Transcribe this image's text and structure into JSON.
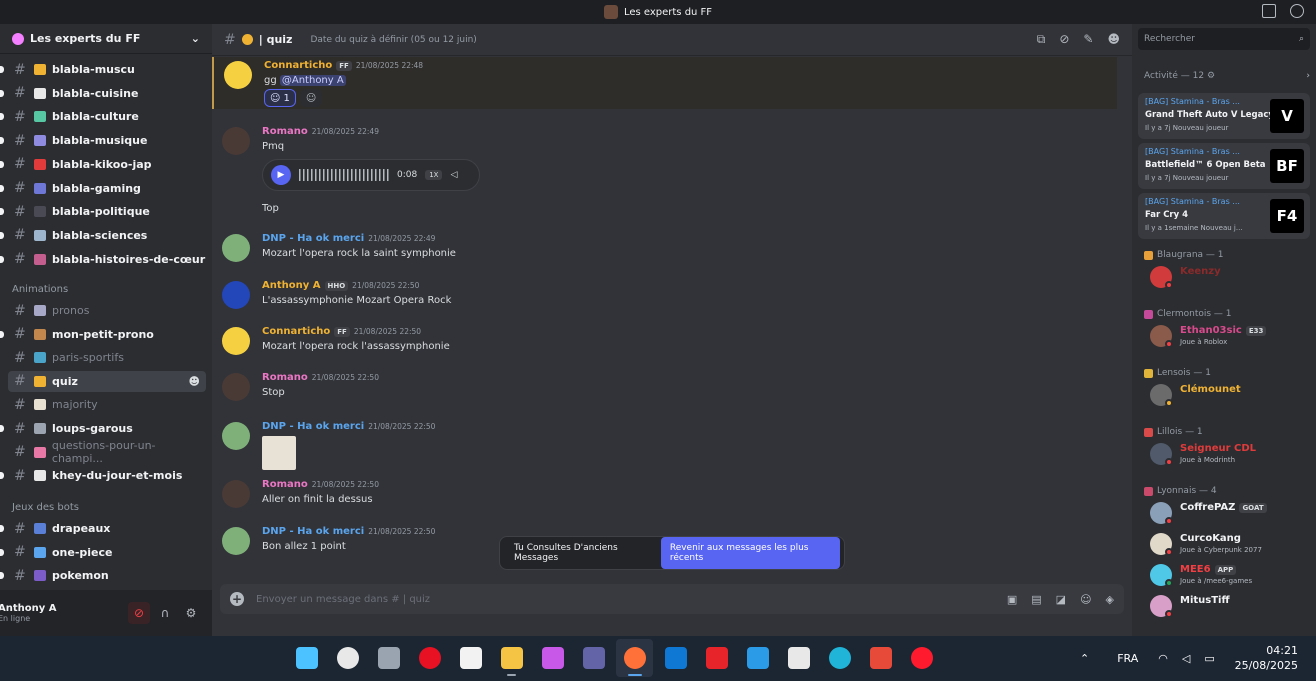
{
  "window": {
    "title": "Les experts du FF"
  },
  "server": {
    "name": "Les experts du FF"
  },
  "channels": [
    {
      "name": "blabla-muscu",
      "emoji_color": "#f0b232",
      "unread": true
    },
    {
      "name": "blabla-cuisine",
      "emoji_color": "#e8e8e8",
      "unread": true
    },
    {
      "name": "blabla-culture",
      "emoji_color": "#57c7a3",
      "unread": true
    },
    {
      "name": "blabla-musique",
      "emoji_color": "#8e8be0",
      "unread": true
    },
    {
      "name": "blabla-kikoo-jap",
      "emoji_color": "#e23b3b",
      "unread": true
    },
    {
      "name": "blabla-gaming",
      "emoji_color": "#6e76d6",
      "unread": true
    },
    {
      "name": "blabla-politique",
      "emoji_color": "#4a4a55",
      "unread": true
    },
    {
      "name": "blabla-sciences",
      "emoji_color": "#9fb6cf",
      "unread": true
    },
    {
      "name": "blabla-histoires-de-cœur",
      "emoji_color": "#c45e8e",
      "unread": true
    }
  ],
  "categories": {
    "animations": "Animations",
    "bots": "Jeux des bots"
  },
  "animation_channels": [
    {
      "name": "pronos",
      "emoji_color": "#a7a7c7",
      "muted": true,
      "unread": false
    },
    {
      "name": "mon-petit-prono",
      "emoji_color": "#c2874c",
      "muted": false,
      "unread": true
    },
    {
      "name": "paris-sportifs",
      "emoji_color": "#4aa3c8",
      "muted": true,
      "unread": false
    },
    {
      "name": "quiz",
      "emoji_color": "#f0b232",
      "muted": false,
      "unread": false,
      "active": true
    },
    {
      "name": "majority",
      "emoji_color": "#e8e0d0",
      "muted": true,
      "unread": false
    },
    {
      "name": "loups-garous",
      "emoji_color": "#9ba4b0",
      "muted": false,
      "unread": true
    },
    {
      "name": "questions-pour-un-champi...",
      "emoji_color": "#e879a6",
      "muted": true,
      "unread": false
    },
    {
      "name": "khey-du-jour-et-mois",
      "emoji_color": "#e8e8e8",
      "muted": false,
      "unread": true
    }
  ],
  "bot_channels": [
    {
      "name": "drapeaux",
      "emoji_color": "#5a7fd6",
      "unread": true
    },
    {
      "name": "one-piece",
      "emoji_color": "#5aa5ee",
      "unread": true
    },
    {
      "name": "pokemon",
      "emoji_color": "#7c5cc9",
      "unread": true
    }
  ],
  "user": {
    "name": "Anthony A",
    "status": "En ligne"
  },
  "channel_header": {
    "name": "| quiz",
    "topic": "Date du quiz à définir (05 ou 12 juin)"
  },
  "messages": [
    {
      "author": "Connarticho",
      "color": "#f0b232",
      "tag": "FF",
      "time": "21/08/2025 22:48",
      "text_pre": "gg ",
      "mention": "@Anthony A",
      "highlight": true,
      "reaction_count": "1",
      "avatar_color": "#f5d142"
    },
    {
      "author": "Romano",
      "color": "#eb76c4",
      "time": "21/08/2025 22:49",
      "text": "Pmq",
      "voice_time": "0:08",
      "voice_speed": "1X",
      "after_voice": "Top",
      "avatar_color": "#4a3a36"
    },
    {
      "author": "DNP - Ha ok merci",
      "color": "#5aa5ee",
      "time": "21/08/2025 22:49",
      "text": "Mozart l'opera rock la saint symphonie",
      "avatar_color": "#7fb07a"
    },
    {
      "author": "Anthony A",
      "color": "#f0b232",
      "tag": "HHO",
      "time": "21/08/2025 22:50",
      "text": "L'assassymphonie  Mozart Opera Rock",
      "avatar_color": "#2346b8"
    },
    {
      "author": "Connarticho",
      "color": "#f0b232",
      "tag": "FF",
      "time": "21/08/2025 22:50",
      "text": "Mozart l'opera rock l'assassymphonie",
      "avatar_color": "#f5d142"
    },
    {
      "author": "Romano",
      "color": "#eb76c4",
      "time": "21/08/2025 22:50",
      "text": "Stop",
      "avatar_color": "#4a3a36"
    },
    {
      "author": "DNP - Ha ok merci",
      "color": "#5aa5ee",
      "time": "21/08/2025 22:50",
      "text": "",
      "sticker": true,
      "avatar_color": "#7fb07a"
    },
    {
      "author": "Romano",
      "color": "#eb76c4",
      "time": "21/08/2025 22:50",
      "text": "Aller on finit la dessus",
      "avatar_color": "#4a3a36"
    },
    {
      "author": "DNP - Ha ok merci",
      "color": "#5aa5ee",
      "time": "21/08/2025 22:50",
      "text": "Bon allez 1 point",
      "avatar_color": "#7fb07a"
    }
  ],
  "jump_bar": {
    "text": "Tu Consultes D'anciens Messages",
    "button": "Revenir aux messages les plus récents"
  },
  "composer": {
    "placeholder": "Envoyer un message dans # | quiz"
  },
  "search": {
    "placeholder": "Rechercher"
  },
  "activity": {
    "header": "Activité — 12",
    "cards": [
      {
        "user": "[BAG] Stamina - Bras ...",
        "game": "Grand Theft Auto V Legacy",
        "meta": "Il y a 7j  Nouveau joueur",
        "img": "V"
      },
      {
        "user": "[BAG] Stamina - Bras ...",
        "game": "Battlefield™ 6 Open Beta",
        "meta": "Il y a 7j  Nouveau joueur",
        "img": "BF"
      },
      {
        "user": "[BAG] Stamina - Bras ...",
        "game": "Far Cry 4",
        "meta": "Il y a 1semaine  Nouveau j...",
        "img": "F4"
      }
    ]
  },
  "roles": [
    {
      "name": "Blaugrana — 1",
      "color": "#e8a13a",
      "members": [
        {
          "name": "Keenzy",
          "color": "#8b2a2a",
          "sub": "",
          "av": "#d23b3b",
          "status": "#f23f43"
        }
      ]
    },
    {
      "name": "Clermontois — 1",
      "color": "#c64a9a",
      "members": [
        {
          "name": "Ethan03sic",
          "tag": "E33",
          "color": "#d94a8c",
          "sub": "Joue à Roblox",
          "av": "#8a5a4a",
          "status": "#f23f43"
        }
      ]
    },
    {
      "name": "Lensois — 1",
      "color": "#e0b33a",
      "members": [
        {
          "name": "Clémounet",
          "color": "#f0b232",
          "sub": "",
          "av": "#6b6b6b",
          "status": "#f0b232"
        }
      ]
    },
    {
      "name": "Lillois — 1",
      "color": "#d94a4a",
      "members": [
        {
          "name": "Seigneur CDL",
          "color": "#e03b3b",
          "sub": "Joue à Modrinth",
          "av": "#505a6a",
          "status": "#f23f43"
        }
      ]
    },
    {
      "name": "Lyonnais — 4",
      "color": "#c94a6a",
      "members": [
        {
          "name": "CoffrePAZ",
          "tag": "GOAT",
          "color": "#f2f3f5",
          "sub": "",
          "av": "#8aa0b8",
          "status": "#f23f43"
        },
        {
          "name": "CurcoKang",
          "color": "#f2f3f5",
          "sub": "Joue à Cyberpunk 2077",
          "av": "#e0d8c8",
          "status": "#f23f43"
        },
        {
          "name": "MEE6",
          "tag": "APP",
          "color": "#f23f43",
          "sub": "Joue à /mee6-games",
          "av": "#4fc8e8",
          "status": "#23a55a"
        },
        {
          "name": "MitusTiff",
          "color": "#f2f3f5",
          "sub": "",
          "av": "#d8a0c8",
          "status": "#f23f43"
        }
      ]
    }
  ],
  "taskbar": {
    "apps": [
      {
        "name": "start",
        "color": "#4cc2ff"
      },
      {
        "name": "search",
        "color": "#e8e8e8"
      },
      {
        "name": "task-view",
        "color": "#9aa4b1"
      },
      {
        "name": "record",
        "color": "#e81123"
      },
      {
        "name": "notepad",
        "color": "#f2f2f2"
      },
      {
        "name": "explorer",
        "color": "#f6c445"
      },
      {
        "name": "m365",
        "color": "#c858e8"
      },
      {
        "name": "teams",
        "color": "#6264a7"
      },
      {
        "name": "firefox",
        "color": "#ff7139",
        "active": true
      },
      {
        "name": "outlook",
        "color": "#0f78d4"
      },
      {
        "name": "tlc",
        "color": "#e8242b"
      },
      {
        "name": "myhp",
        "color": "#2b9be8"
      },
      {
        "name": "store",
        "color": "#e8e8e8"
      },
      {
        "name": "edge",
        "color": "#1fb4d8"
      },
      {
        "name": "ccleaner",
        "color": "#e84a3a"
      },
      {
        "name": "opera",
        "color": "#ff1b2d"
      }
    ],
    "lang": "FRA",
    "time": "04:21",
    "date": "25/08/2025"
  }
}
